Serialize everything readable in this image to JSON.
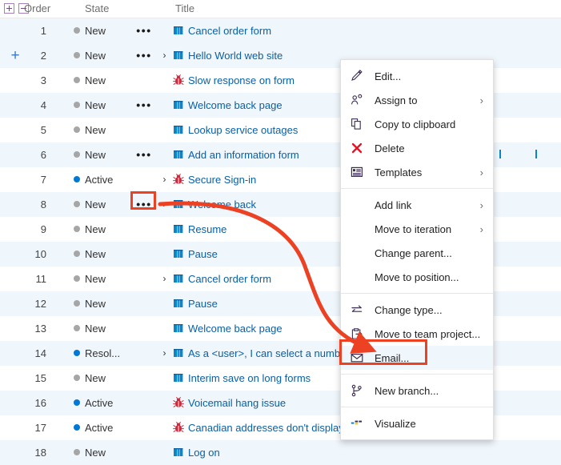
{
  "grid": {
    "columns": [
      {
        "key": "order",
        "label": "Order"
      },
      {
        "key": "state",
        "label": "State"
      },
      {
        "key": "title",
        "label": "Title"
      }
    ],
    "expand_icon": "expand-all-icon",
    "collapse_icon": "collapse-all-icon",
    "add_row_icon": "add-child-icon",
    "colors": {
      "row_alt": "#eff6fc",
      "state_new": "#a6a6a6",
      "state_active": "#0078d4",
      "state_resolved": "#0078d4",
      "title_link": "#0a5fa5",
      "story_icon": "#0a86c8",
      "bug_icon": "#cc293d",
      "annotation": "#ec4123"
    },
    "rows": [
      {
        "order": "1",
        "state": "New",
        "state_kind": "new",
        "ellipsis": true,
        "chevron": false,
        "icon": "story-icon",
        "title": "Cancel order form",
        "selected": true,
        "add": false
      },
      {
        "order": "2",
        "state": "New",
        "state_kind": "new",
        "ellipsis": true,
        "chevron": true,
        "icon": "story-icon",
        "title": "Hello World web site",
        "selected": true,
        "add": true
      },
      {
        "order": "3",
        "state": "New",
        "state_kind": "new",
        "ellipsis": false,
        "chevron": false,
        "icon": "bug-icon",
        "title": "Slow response on form",
        "selected": false,
        "add": false
      },
      {
        "order": "4",
        "state": "New",
        "state_kind": "new",
        "ellipsis": true,
        "chevron": false,
        "icon": "story-icon",
        "title": "Welcome back page",
        "selected": true,
        "add": false
      },
      {
        "order": "5",
        "state": "New",
        "state_kind": "new",
        "ellipsis": false,
        "chevron": false,
        "icon": "story-icon",
        "title": "Lookup service outages",
        "selected": false,
        "add": false
      },
      {
        "order": "6",
        "state": "New",
        "state_kind": "new",
        "ellipsis": true,
        "chevron": false,
        "icon": "story-icon",
        "title": "Add an information form",
        "selected": true,
        "add": false
      },
      {
        "order": "7",
        "state": "Active",
        "state_kind": "active",
        "ellipsis": false,
        "chevron": true,
        "icon": "bug-icon",
        "title": "Secure Sign-in",
        "selected": false,
        "add": false
      },
      {
        "order": "8",
        "state": "New",
        "state_kind": "new",
        "ellipsis": true,
        "chevron": true,
        "icon": "story-icon",
        "title": "Welcome back",
        "selected": true,
        "add": false
      },
      {
        "order": "9",
        "state": "New",
        "state_kind": "new",
        "ellipsis": false,
        "chevron": false,
        "icon": "story-icon",
        "title": "Resume",
        "selected": false,
        "add": false
      },
      {
        "order": "10",
        "state": "New",
        "state_kind": "new",
        "ellipsis": false,
        "chevron": false,
        "icon": "story-icon",
        "title": "Pause",
        "selected": false,
        "add": false
      },
      {
        "order": "11",
        "state": "New",
        "state_kind": "new",
        "ellipsis": false,
        "chevron": true,
        "icon": "story-icon",
        "title": "Cancel order form",
        "selected": false,
        "add": false
      },
      {
        "order": "12",
        "state": "New",
        "state_kind": "new",
        "ellipsis": false,
        "chevron": false,
        "icon": "story-icon",
        "title": "Pause",
        "selected": false,
        "add": false
      },
      {
        "order": "13",
        "state": "New",
        "state_kind": "new",
        "ellipsis": false,
        "chevron": false,
        "icon": "story-icon",
        "title": "Welcome back page",
        "selected": false,
        "add": false
      },
      {
        "order": "14",
        "state": "Resol...",
        "state_kind": "resolved",
        "ellipsis": false,
        "chevron": true,
        "icon": "story-icon",
        "title": "As a <user>, I can select a numbe",
        "selected": false,
        "add": false
      },
      {
        "order": "15",
        "state": "New",
        "state_kind": "new",
        "ellipsis": false,
        "chevron": false,
        "icon": "story-icon",
        "title": "Interim save on long forms",
        "selected": false,
        "add": false
      },
      {
        "order": "16",
        "state": "Active",
        "state_kind": "active",
        "ellipsis": false,
        "chevron": false,
        "icon": "bug-icon",
        "title": "Voicemail hang issue",
        "selected": false,
        "add": false
      },
      {
        "order": "17",
        "state": "Active",
        "state_kind": "active",
        "ellipsis": false,
        "chevron": false,
        "icon": "bug-icon",
        "title": "Canadian addresses don't display",
        "selected": false,
        "add": false
      },
      {
        "order": "18",
        "state": "New",
        "state_kind": "new",
        "ellipsis": false,
        "chevron": false,
        "icon": "story-icon",
        "title": "Log on",
        "selected": false,
        "add": false
      }
    ]
  },
  "context_menu": {
    "groups": [
      [
        {
          "label": "Edit...",
          "icon": "pencil-icon",
          "submenu": false,
          "highlight": false
        },
        {
          "label": "Assign to",
          "icon": "person-assign-icon",
          "submenu": true,
          "highlight": false
        },
        {
          "label": "Copy to clipboard",
          "icon": "copy-icon",
          "submenu": false,
          "highlight": false
        },
        {
          "label": "Delete",
          "icon": "delete-x-icon",
          "submenu": false,
          "highlight": false
        },
        {
          "label": "Templates",
          "icon": "templates-icon",
          "submenu": true,
          "highlight": false
        }
      ],
      [
        {
          "label": "Add link",
          "icon": null,
          "submenu": true,
          "highlight": false
        },
        {
          "label": "Move to iteration",
          "icon": null,
          "submenu": true,
          "highlight": false
        },
        {
          "label": "Change parent...",
          "icon": null,
          "submenu": false,
          "highlight": false
        },
        {
          "label": "Move to position...",
          "icon": null,
          "submenu": false,
          "highlight": false
        }
      ],
      [
        {
          "label": "Change type...",
          "icon": "change-type-icon",
          "submenu": false,
          "highlight": false
        },
        {
          "label": "Move to team project...",
          "icon": "move-project-icon",
          "submenu": false,
          "highlight": false
        },
        {
          "label": "Email...",
          "icon": "email-icon",
          "submenu": false,
          "highlight": true
        }
      ],
      [
        {
          "label": "New branch...",
          "icon": "branch-icon",
          "submenu": false,
          "highlight": false
        }
      ],
      [
        {
          "label": "Visualize",
          "icon": "visualize-icon",
          "submenu": false,
          "highlight": false
        }
      ]
    ],
    "submenu_glyph": "chevron-right-icon"
  },
  "annotations": {
    "source_box": "row-8-ellipsis-highlight",
    "target_box": "email-menu-item-highlight",
    "arrow": "curved-arrow-pointing-to-email"
  }
}
